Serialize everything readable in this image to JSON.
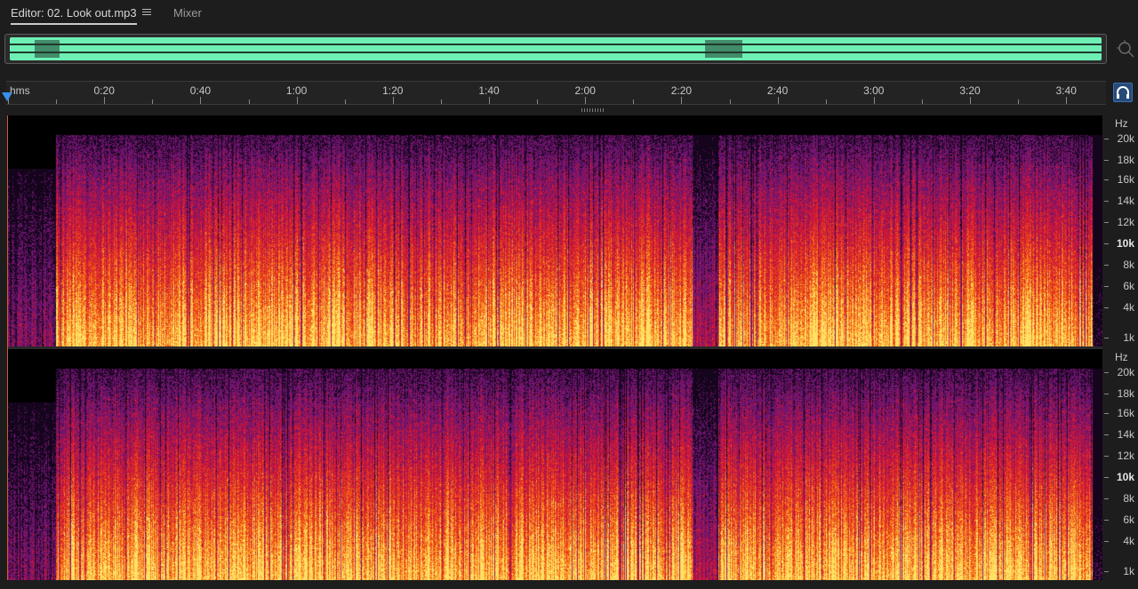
{
  "tabs": {
    "editor_label": "Editor: 02. Look out.mp3",
    "mixer_label": "Mixer"
  },
  "ruler": {
    "unit": "hms",
    "labels": [
      "0:20",
      "0:40",
      "1:00",
      "1:20",
      "1:40",
      "2:00",
      "2:20",
      "2:40",
      "3:00",
      "3:20",
      "3:40"
    ]
  },
  "freq_axis": {
    "unit": "Hz",
    "labels": [
      "20k",
      "18k",
      "16k",
      "14k",
      "12k",
      "10k",
      "8k",
      "6k",
      "4k",
      "1k"
    ],
    "bold_label": "10k"
  },
  "colors": {
    "overview_wave": "#6ef0b5",
    "playhead": "#3a8fe8",
    "spec_low": "#ffe066",
    "spec_mid": "#e8401c",
    "spec_high": "#8a1a6e",
    "spec_quiet": "#000000"
  },
  "icons": {
    "zoom": "zoom-navigator-icon",
    "snap": "headphones-snap-icon",
    "menu": "hamburger-menu-icon"
  }
}
